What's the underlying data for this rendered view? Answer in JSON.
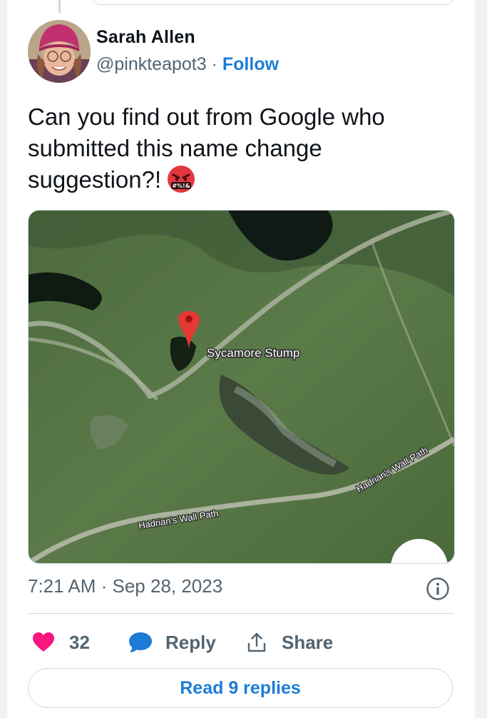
{
  "author": {
    "name": "Sarah Allen",
    "handle": "@pinkteapot3",
    "separator": "·",
    "follow_label": "Follow"
  },
  "tweet": {
    "text_lines": [
      "Can you find out from Google who",
      "submitted this name change",
      "suggestion?!"
    ],
    "emoji": "angry-face-with-symbols-icon",
    "emoji_symbols": "#%!&"
  },
  "map": {
    "pin_label": "Sycamore Stump",
    "path_label_left": "Hadrian's Wall Path",
    "path_label_right": "Hadrian's Wall Path"
  },
  "timestamp": "7:21 AM · Sep 28, 2023",
  "actions": {
    "like_count": "32",
    "reply_label": "Reply",
    "share_label": "Share"
  },
  "read_replies_label": "Read 9 replies",
  "colors": {
    "accent": "#1d7bd8",
    "like": "#f91880",
    "muted": "#536471"
  }
}
